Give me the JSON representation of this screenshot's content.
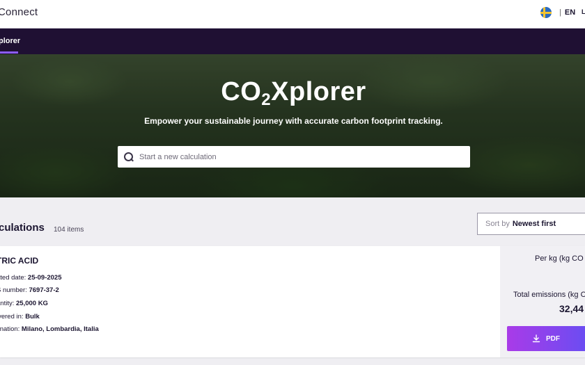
{
  "header": {
    "brand": "Connect",
    "language": "EN",
    "separator": "|",
    "user_initial": "L"
  },
  "nav": {
    "active_tab": "plorer"
  },
  "hero": {
    "title_prefix": "CO",
    "title_subscript": "2",
    "title_suffix": "Xplorer",
    "subtitle": "Empower your sustainable journey with accurate carbon footprint tracking.",
    "search_placeholder": "Start a new calculation"
  },
  "list": {
    "title": "culations",
    "count": "104 items",
    "sort_label": "Sort by",
    "sort_value": "Newest first"
  },
  "card": {
    "name": "TRIC ACID",
    "details": [
      {
        "label": "ated date:",
        "value": "25-09-2025"
      },
      {
        "label": "S number:",
        "value": "7697-37-2"
      },
      {
        "label": "antity:",
        "value": "25,000 KG"
      },
      {
        "label": "ivered in:",
        "value": "Bulk"
      },
      {
        "label": "tination:",
        "value": "Milano, Lombardia, Italia"
      }
    ],
    "per_kg_label": "Per kg (kg CO",
    "total_label": "Total emissions (kg C",
    "total_value": "32,44",
    "pdf_label": "PDF"
  },
  "colors": {
    "nav_bg": "#1f1033",
    "accent": "#8b5cf6",
    "pdf_gradient_start": "#a93be8",
    "pdf_gradient_end": "#6a4df2"
  }
}
